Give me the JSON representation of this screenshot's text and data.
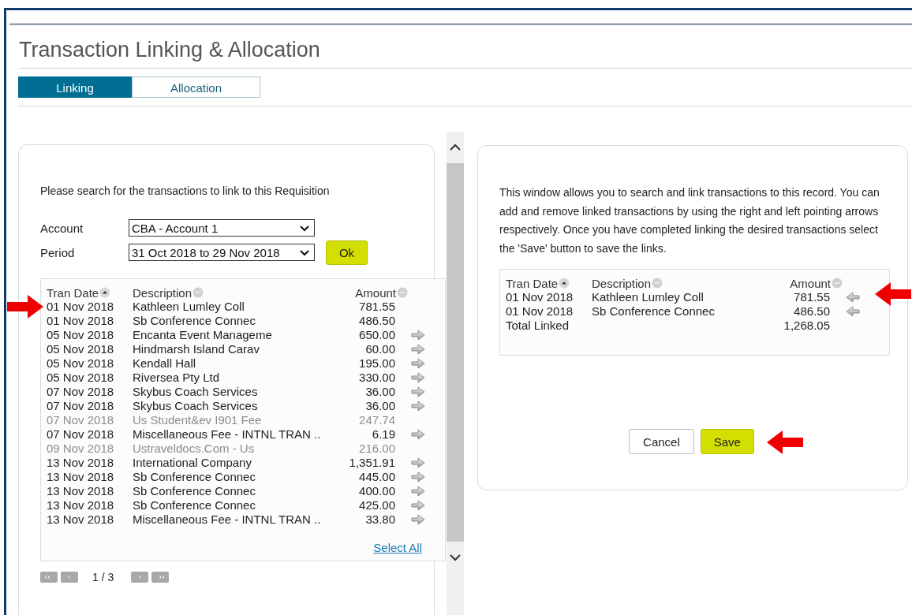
{
  "page": {
    "title": "Transaction Linking & Allocation"
  },
  "tabs": [
    {
      "label": "Linking",
      "selected": true
    },
    {
      "label": "Allocation",
      "selected": false
    }
  ],
  "search_panel": {
    "instruction": "Please search for the transactions to link to this Requisition",
    "fields": [
      {
        "label": "Account",
        "value": "CBA - Account 1"
      },
      {
        "label": "Period",
        "value": "31 Oct 2018 to 29 Nov 2018"
      }
    ],
    "ok_button": "Ok",
    "table": {
      "columns": [
        {
          "label": "Tran Date",
          "sorted": true
        },
        {
          "label": "Description",
          "sorted": false
        },
        {
          "label": "Amount",
          "sorted": false
        }
      ],
      "rows": [
        {
          "date": "01 Nov 2018",
          "description": "Kathleen Lumley Coll",
          "amount": "781.55",
          "kind": "linked",
          "highlighted": true
        },
        {
          "date": "01 Nov 2018",
          "description": "Sb Conference Connec",
          "amount": "486.50",
          "kind": "linked",
          "highlighted": false
        },
        {
          "date": "05 Nov 2018",
          "description": "Encanta Event Manageme",
          "amount": "650.00",
          "kind": "available",
          "highlighted": false
        },
        {
          "date": "05 Nov 2018",
          "description": "Hindmarsh Island Carav",
          "amount": "60.00",
          "kind": "available",
          "highlighted": false
        },
        {
          "date": "05 Nov 2018",
          "description": "Kendall Hall",
          "amount": "195.00",
          "kind": "available",
          "highlighted": false
        },
        {
          "date": "05 Nov 2018",
          "description": "Riversea Pty Ltd",
          "amount": "330.00",
          "kind": "available",
          "highlighted": false
        },
        {
          "date": "07 Nov 2018",
          "description": "Skybus Coach Services",
          "amount": "36.00",
          "kind": "available",
          "highlighted": false
        },
        {
          "date": "07 Nov 2018",
          "description": "Skybus Coach Services",
          "amount": "36.00",
          "kind": "available",
          "highlighted": false
        },
        {
          "date": "07 Nov 2018",
          "description": "Us Student&ev I901 Fee",
          "amount": "247.74",
          "kind": "unavailable",
          "highlighted": false
        },
        {
          "date": "07 Nov 2018",
          "description": "Miscellaneous Fee - INTNL TRAN ..",
          "amount": "6.19",
          "kind": "available",
          "highlighted": false
        },
        {
          "date": "09 Nov 2018",
          "description": "Ustraveldocs.Com - Us",
          "amount": "216.00",
          "kind": "unavailable",
          "highlighted": false
        },
        {
          "date": "13 Nov 2018",
          "description": "International Company",
          "amount": "1,351.91",
          "kind": "available",
          "highlighted": false
        },
        {
          "date": "13 Nov 2018",
          "description": "Sb Conference Connec",
          "amount": "445.00",
          "kind": "available",
          "highlighted": false
        },
        {
          "date": "13 Nov 2018",
          "description": "Sb Conference Connec",
          "amount": "400.00",
          "kind": "available",
          "highlighted": false
        },
        {
          "date": "13 Nov 2018",
          "description": "Sb Conference Connec",
          "amount": "425.00",
          "kind": "available",
          "highlighted": false
        },
        {
          "date": "13 Nov 2018",
          "description": "Miscellaneous Fee - INTNL TRAN ..",
          "amount": "33.80",
          "kind": "available",
          "highlighted": false
        }
      ],
      "select_all": "Select All"
    },
    "pagination": "1 / 3"
  },
  "linked_panel": {
    "instructions": "This window allows you to search and link transactions to this record. You can add and remove linked transactions by using the right and left pointing arrows respectively. Once you have completed linking the desired transactions select the 'Save' button to save the links.",
    "table": {
      "columns": [
        {
          "label": "Tran Date",
          "sorted": true
        },
        {
          "label": "Description",
          "sorted": false
        },
        {
          "label": "Amount",
          "sorted": false
        }
      ],
      "rows": [
        {
          "date": "01 Nov 2018",
          "description": "Kathleen Lumley Coll",
          "amount": "781.55",
          "highlighted": true
        },
        {
          "date": "01 Nov 2018",
          "description": "Sb Conference Connec",
          "amount": "486.50",
          "highlighted": false
        }
      ],
      "total_label": "Total Linked",
      "total": "1,268.05"
    },
    "buttons": [
      {
        "label": "Cancel",
        "kind": "secondary",
        "highlighted": false
      },
      {
        "label": "Save",
        "kind": "primary",
        "highlighted": true
      }
    ]
  }
}
